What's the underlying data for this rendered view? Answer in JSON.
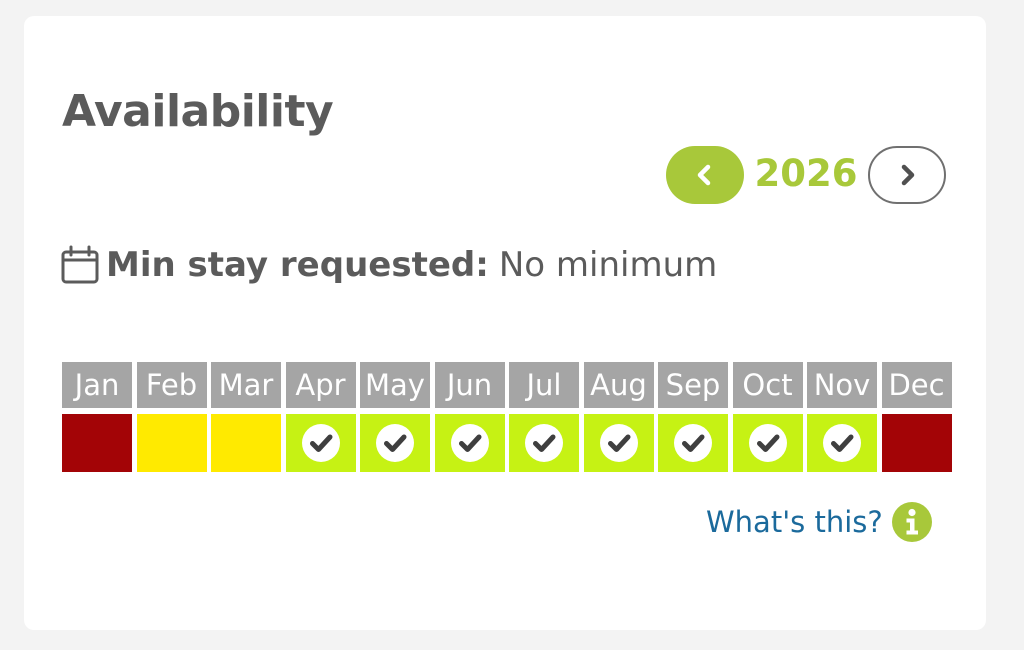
{
  "availability": {
    "title": "Availability",
    "year": "2026",
    "min_stay": {
      "label": "Min stay requested:",
      "value": "No minimum",
      "icon": "calendar-icon"
    },
    "months": [
      {
        "label": "Jan",
        "status": "booked"
      },
      {
        "label": "Feb",
        "status": "partial"
      },
      {
        "label": "Mar",
        "status": "partial"
      },
      {
        "label": "Apr",
        "status": "available"
      },
      {
        "label": "May",
        "status": "available"
      },
      {
        "label": "Jun",
        "status": "available"
      },
      {
        "label": "Jul",
        "status": "available"
      },
      {
        "label": "Aug",
        "status": "available"
      },
      {
        "label": "Sep",
        "status": "available"
      },
      {
        "label": "Oct",
        "status": "available"
      },
      {
        "label": "Nov",
        "status": "available"
      },
      {
        "label": "Dec",
        "status": "booked"
      }
    ],
    "help_link": "What's this?"
  },
  "colors": {
    "booked": "#a30406",
    "partial": "#ffea00",
    "available": "#c6f214",
    "accent": "#a8c83a",
    "link": "#1b6a9c",
    "header_gray": "#a5a5a5"
  },
  "icons": {
    "prev": "chevron-left-icon",
    "next": "chevron-right-icon",
    "available_mark": "check-circle-icon",
    "help": "info-icon"
  }
}
